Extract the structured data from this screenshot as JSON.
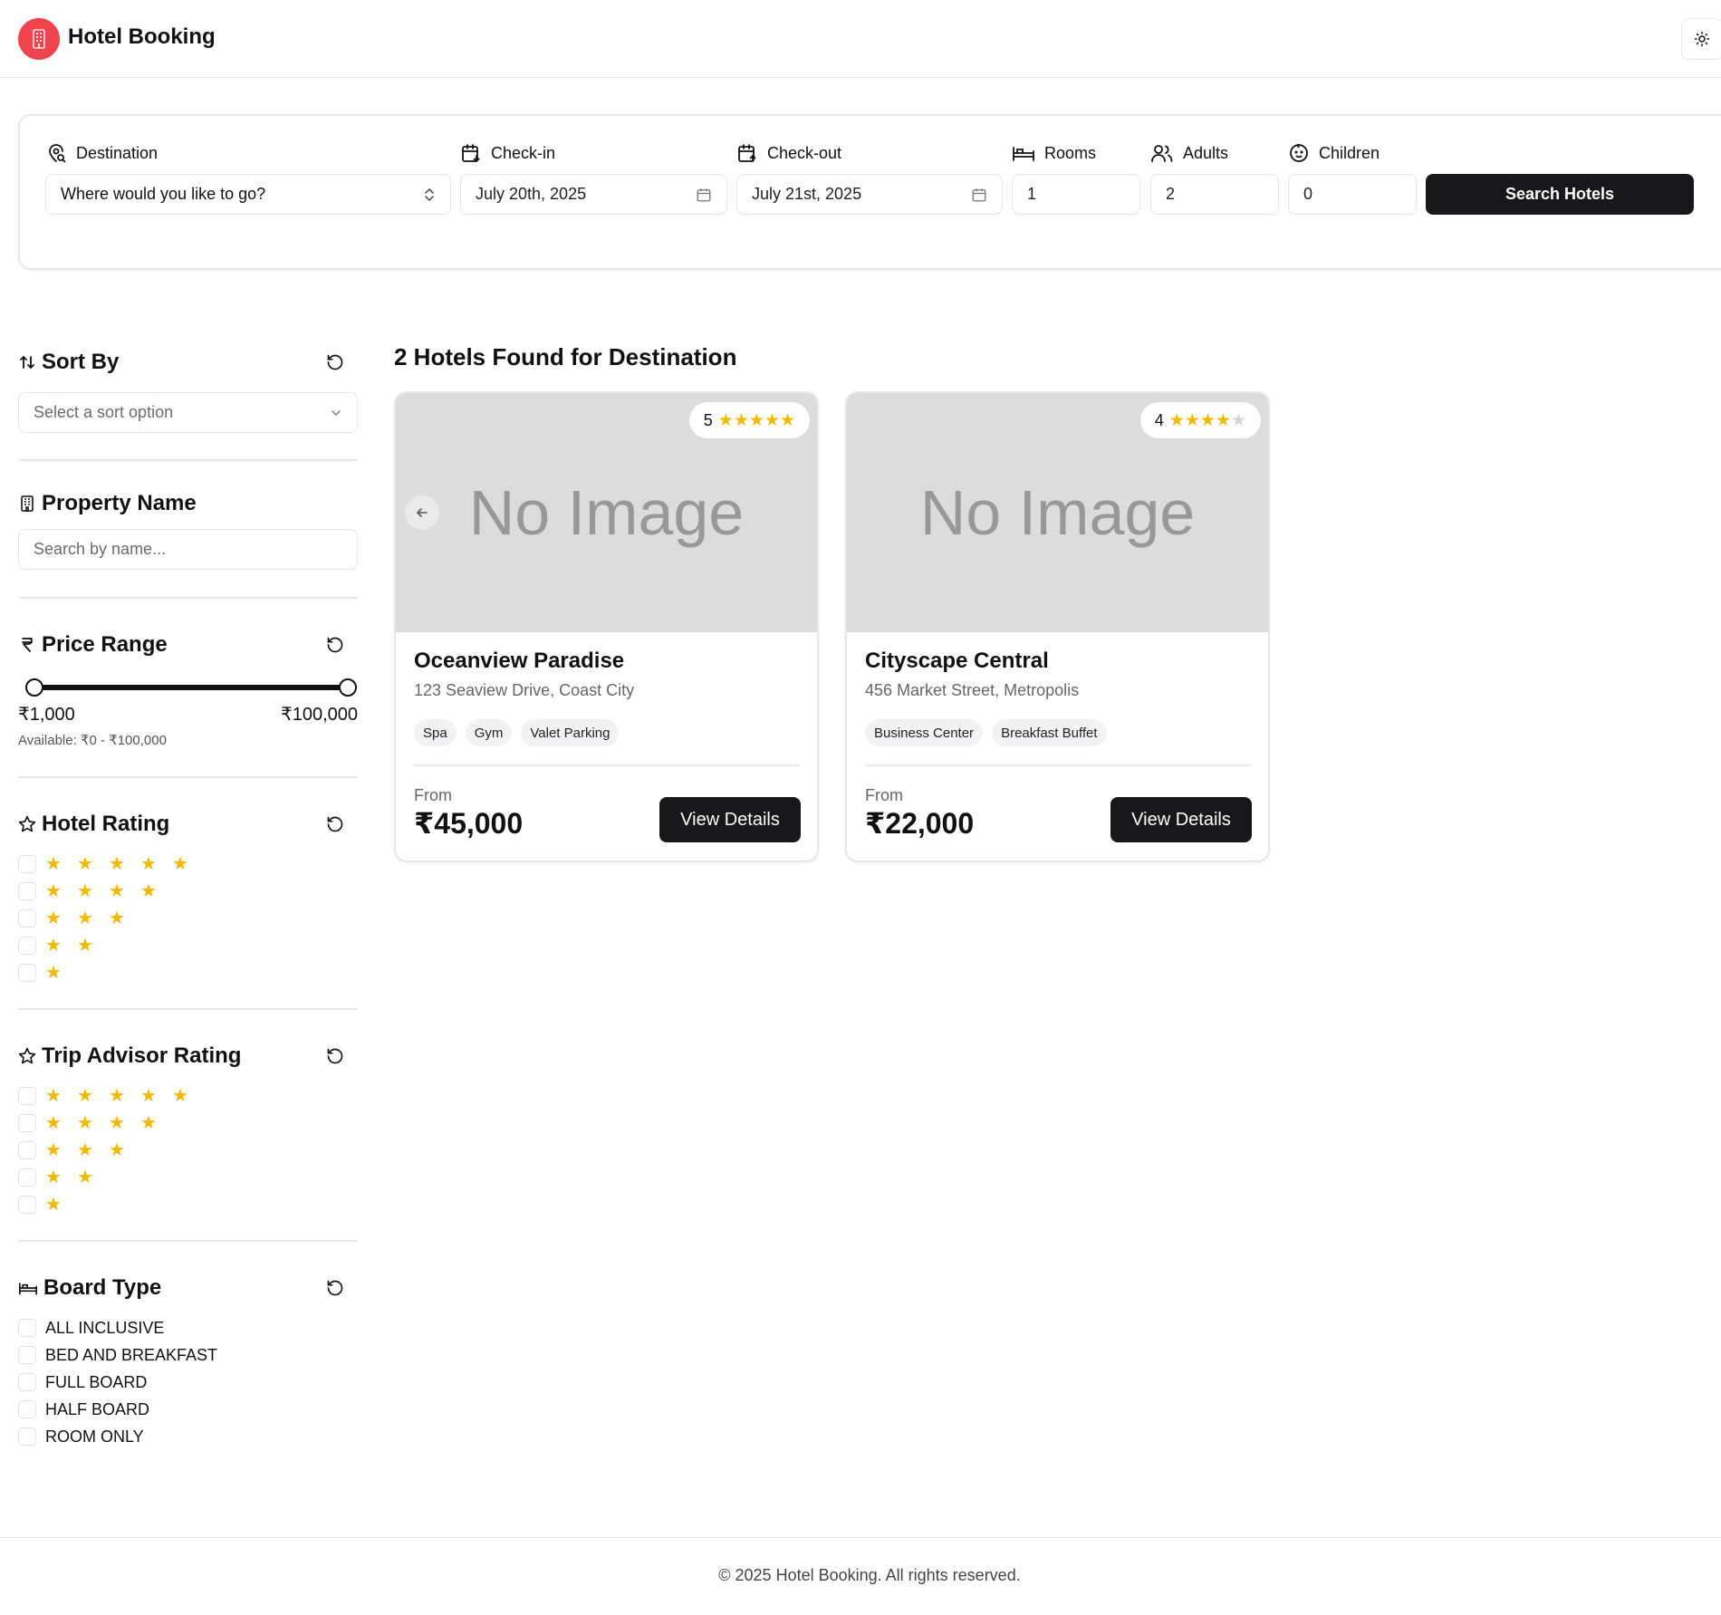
{
  "header": {
    "app_title": "Hotel Booking",
    "logo_icon": "building-icon",
    "theme_icon": "sun-icon",
    "brand_color": "#f0444c"
  },
  "search": {
    "destination_label": "Destination",
    "destination_value": "Where would you like to go?",
    "checkin_label": "Check-in",
    "checkin_value": "July 20th, 2025",
    "checkout_label": "Check-out",
    "checkout_value": "July 21st, 2025",
    "rooms_label": "Rooms",
    "rooms_value": "1",
    "adults_label": "Adults",
    "adults_value": "2",
    "children_label": "Children",
    "children_value": "0",
    "search_button": "Search Hotels"
  },
  "sidebar": {
    "sort": {
      "title": "Sort By",
      "placeholder": "Select a sort option"
    },
    "property": {
      "title": "Property Name",
      "placeholder": "Search by name..."
    },
    "price": {
      "title": "Price Range",
      "min_label": "₹1,000",
      "max_label": "₹100,000",
      "available": "Available: ₹0 - ₹100,000",
      "selected_min": 1000,
      "selected_max": 100000,
      "range_min": 0,
      "range_max": 100000
    },
    "hotel_rating": {
      "title": "Hotel Rating",
      "options": [
        5,
        4,
        3,
        2,
        1
      ]
    },
    "trip_advisor": {
      "title": "Trip Advisor Rating",
      "options": [
        5,
        4,
        3,
        2,
        1
      ]
    },
    "board_type": {
      "title": "Board Type",
      "options": [
        "ALL INCLUSIVE",
        "BED AND BREAKFAST",
        "FULL BOARD",
        "HALF BOARD",
        "ROOM ONLY"
      ]
    },
    "star_color": "#f5b800"
  },
  "results": {
    "title": "2 Hotels Found for Destination",
    "hotels": [
      {
        "image_text": "No Image",
        "rating": "5",
        "stars": 5,
        "name": "Oceanview Paradise",
        "address": "123 Seaview Drive, Coast City",
        "amenities": [
          "Spa",
          "Gym",
          "Valet Parking"
        ],
        "from_label": "From",
        "price": "₹45,000",
        "button": "View Details"
      },
      {
        "image_text": "No Image",
        "rating": "4",
        "stars": 4,
        "name": "Cityscape Central",
        "address": "456 Market Street, Metropolis",
        "amenities": [
          "Business Center",
          "Breakfast Buffet"
        ],
        "from_label": "From",
        "price": "₹22,000",
        "button": "View Details"
      }
    ]
  },
  "footer": {
    "text": "© 2025 Hotel Booking. All rights reserved."
  }
}
